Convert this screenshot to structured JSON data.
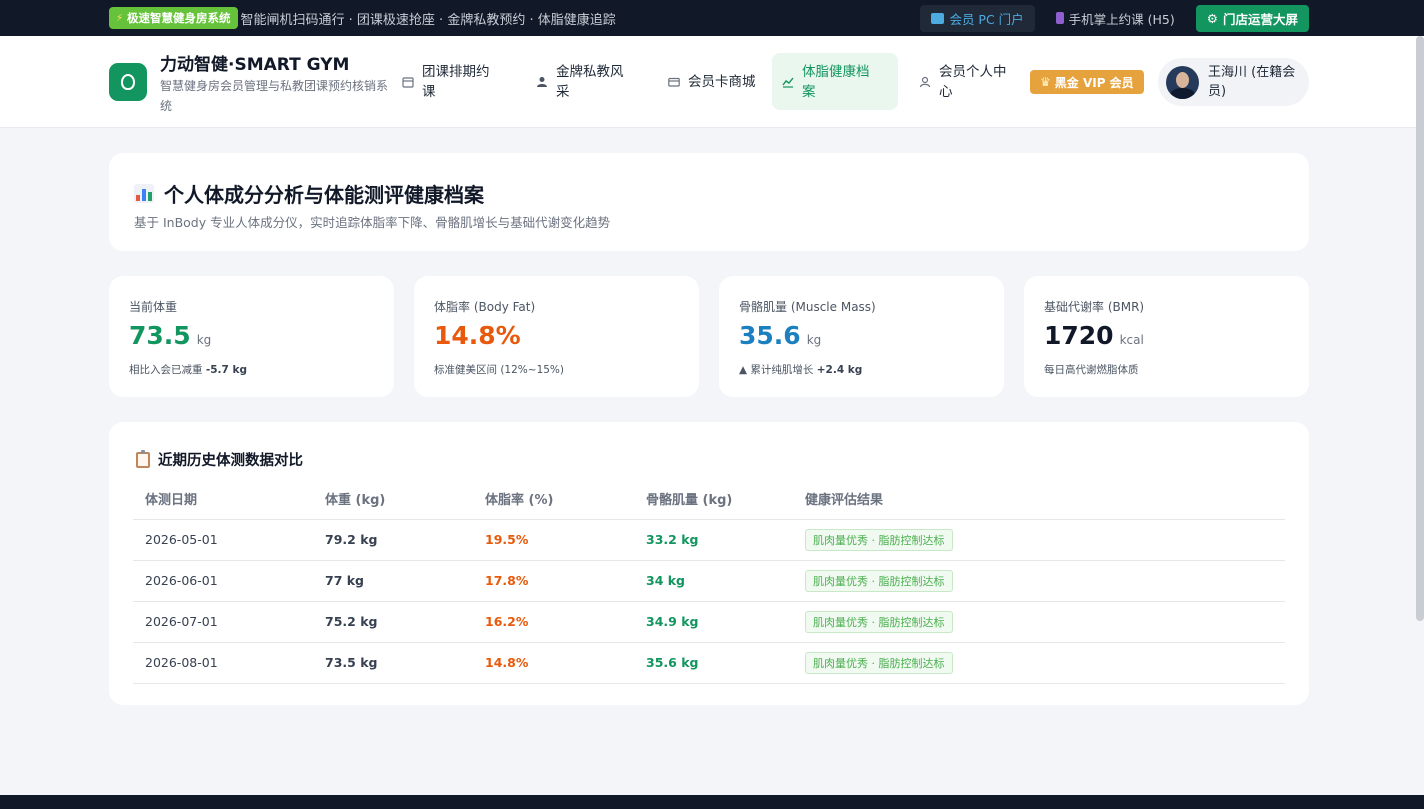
{
  "topbar": {
    "badge": "极速智慧健身房系统",
    "ticker": "智能闸机扫码通行 · 团课极速抢座 · 金牌私教预约 · 体脂健康追踪",
    "links": [
      {
        "label": "会员 PC 门户",
        "icon": "laptop-icon"
      },
      {
        "label": "手机掌上约课 (H5)",
        "icon": "mobile-icon"
      },
      {
        "label": "门店运营大屏",
        "icon": "gear-icon"
      }
    ]
  },
  "header": {
    "brand_title": "力动智健·SMART GYM",
    "brand_subtitle": "智慧健身房会员管理与私教团课预约核销系统",
    "nav": [
      {
        "label": "团课排期约课",
        "icon": "calendar-icon"
      },
      {
        "label": "金牌私教风采",
        "icon": "person-icon"
      },
      {
        "label": "会员卡商城",
        "icon": "card-icon"
      },
      {
        "label": "体脂健康档案",
        "icon": "chart-icon",
        "active": true
      },
      {
        "label": "会员个人中心",
        "icon": "user-icon"
      }
    ],
    "vip_badge": "黑金 VIP 会员",
    "user_name": "王海川 (在籍会员)"
  },
  "hero": {
    "title": "个人体成分分析与体能测评健康档案",
    "subtitle": "基于 InBody 专业人体成分仪，实时追踪体脂率下降、骨骼肌增长与基础代谢变化趋势"
  },
  "stats": [
    {
      "label": "当前体重",
      "value": "73.5",
      "unit": "kg",
      "note_prefix": "相比入会已减重 ",
      "note_value": "-5.7 kg",
      "color": "#12955e"
    },
    {
      "label": "体脂率 (Body Fat)",
      "value": "14.8%",
      "unit": "",
      "note_prefix": "标准健美区间 (12%~15%)",
      "note_value": "",
      "color": "#e8590c"
    },
    {
      "label": "骨骼肌量 (Muscle Mass)",
      "value": "35.6",
      "unit": "kg",
      "note_prefix": "▲ 累计纯肌增长 ",
      "note_value": "+2.4 kg",
      "color": "#1b7fc0"
    },
    {
      "label": "基础代谢率 (BMR)",
      "value": "1720",
      "unit": "kcal",
      "note_prefix": "每日高代谢燃脂体质",
      "note_value": "",
      "color": "#111827"
    }
  ],
  "history": {
    "title": "近期历史体测数据对比",
    "headers": [
      "体测日期",
      "体重 (kg)",
      "体脂率 (%)",
      "骨骼肌量 (kg)",
      "健康评估结果"
    ],
    "rows": [
      {
        "date": "2026-05-01",
        "weight": "79.2 kg",
        "body_fat": "19.5%",
        "muscle": "33.2 kg",
        "result": "肌肉量优秀 · 脂肪控制达标"
      },
      {
        "date": "2026-06-01",
        "weight": "77 kg",
        "body_fat": "17.8%",
        "muscle": "34 kg",
        "result": "肌肉量优秀 · 脂肪控制达标"
      },
      {
        "date": "2026-07-01",
        "weight": "75.2 kg",
        "body_fat": "16.2%",
        "muscle": "34.9 kg",
        "result": "肌肉量优秀 · 脂肪控制达标"
      },
      {
        "date": "2026-08-01",
        "weight": "73.5 kg",
        "body_fat": "14.8%",
        "muscle": "35.6 kg",
        "result": "肌肉量优秀 · 脂肪控制达标"
      }
    ]
  }
}
